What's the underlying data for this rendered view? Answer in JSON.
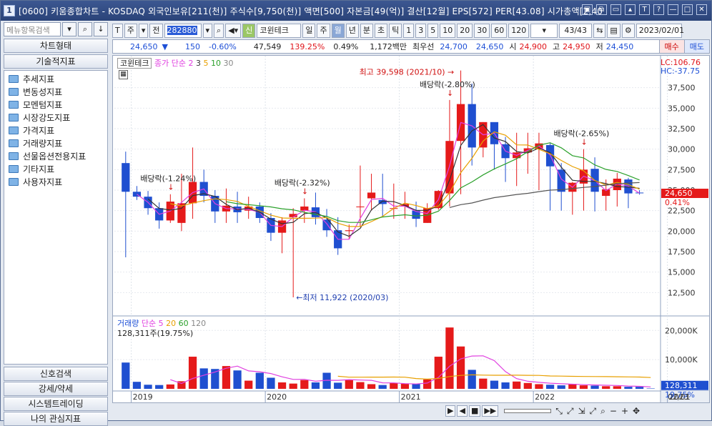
{
  "title": "[0600] 키움종합차트 - KOSDAQ 외국인보유[211(천)] 주식수[9,750(천)] 액면[500] 자본금[49(억)] 결산[12월] EPS[572] PER[43.08] 시가총액[2,40",
  "window_buttons": [
    "▣",
    "⧉",
    "▭",
    "▴",
    "T",
    "?",
    "—",
    "□",
    "✕"
  ],
  "left": {
    "search_placeholder": "메뉴항목검색",
    "tab_chart_type": "차트형태",
    "tab_indicator": "기술적지표",
    "tree_items": [
      "추세지표",
      "변동성지표",
      "모멘텀지표",
      "시장강도지표",
      "가격지표",
      "거래량지표",
      "선물옵션전용지표",
      "기타지표",
      "사용자지표"
    ],
    "bottom_tabs": [
      "신호검색",
      "강세/약세",
      "시스템트레이딩",
      "나의 관심지표"
    ]
  },
  "toolbar": {
    "btn_t": "T",
    "btn_ju": "주",
    "btn_jeon": "전",
    "code": "282880",
    "stock_tag": "신",
    "stock_name": "코윈테크",
    "periods": [
      "일",
      "주",
      "월",
      "년",
      "분",
      "초",
      "틱"
    ],
    "active_period": "월",
    "intervals": [
      "1",
      "3",
      "5",
      "10",
      "20",
      "30",
      "60",
      "120"
    ],
    "page": "43/43",
    "date": "2023/02/01"
  },
  "quote": {
    "price": "24,650",
    "arrow": "▼",
    "change": "150",
    "change_pct": "-0.60%",
    "volume": "47,549",
    "vol_ratio": "139.25%",
    "turnover_pct": "0.49%",
    "amount": "1,172백만",
    "best_ask_label": "최우선",
    "best_ask": "24,700",
    "best_bid": "24,650",
    "open_label": "시",
    "open": "24,900",
    "high_label": "고",
    "high": "24,950",
    "low_label": "저",
    "low": "24,450",
    "buy": "매수",
    "sell": "매도"
  },
  "price_panel": {
    "legend_name": "코윈테크",
    "legend_ma": "종가 단순",
    "ma_periods": [
      "2",
      "3",
      "5",
      "10",
      "30"
    ],
    "lc": "LC:106.76",
    "hc": "HC:-37.75",
    "current_label": "24,650",
    "current_pct": "0.41%",
    "y_ticks": [
      "37,500",
      "35,000",
      "32,500",
      "30,000",
      "27,500",
      "25,000",
      "22,500",
      "20,000",
      "17,500",
      "15,000",
      "12,500"
    ],
    "annotations": {
      "high": "최고 39,598 (2021/10)",
      "low": "최저 11,922 (2020/03)",
      "div1": "배당락(-1.24%)",
      "div2": "배당락(-2.32%)",
      "div3": "배당락(-2.80%)",
      "div4": "배당락(-2.65%)"
    }
  },
  "volume_panel": {
    "legend_name": "거래량",
    "legend_ma": "단순",
    "ma_periods": [
      "5",
      "20",
      "60",
      "120"
    ],
    "last_volume": "128,311주(19.75%)",
    "current_label": "128,311",
    "current_pct": "19.75%",
    "y_ticks": [
      "20,000K",
      "10,000K"
    ]
  },
  "x_axis": [
    "2019",
    "2020",
    "2021",
    "2022",
    "2023"
  ],
  "x_right_label": "02/01",
  "colors": {
    "up": "#e51a1a",
    "down": "#1f4fd0",
    "ma2": "#e040e0",
    "ma5": "#e8a000",
    "ma10": "#2aa02a"
  },
  "chart_data": {
    "type": "candlestick",
    "categories": [
      "2018/12",
      "2019/01",
      "2019/02",
      "2019/03",
      "2019/04",
      "2019/05",
      "2019/06",
      "2019/07",
      "2019/08",
      "2019/09",
      "2019/10",
      "2019/11",
      "2019/12",
      "2020/01",
      "2020/02",
      "2020/03",
      "2020/04",
      "2020/05",
      "2020/06",
      "2020/07",
      "2020/08",
      "2020/09",
      "2020/10",
      "2020/11",
      "2020/12",
      "2021/01",
      "2021/02",
      "2021/03",
      "2021/04",
      "2021/05",
      "2021/06",
      "2021/07",
      "2021/08",
      "2021/09",
      "2021/10",
      "2021/11",
      "2021/12",
      "2022/01",
      "2022/02",
      "2022/03",
      "2022/04",
      "2022/05",
      "2022/06",
      "2022/07",
      "2022/08",
      "2022/09",
      "2022/10",
      "2022/11",
      "2022/12",
      "2023/01",
      "2023/02"
    ],
    "open": [
      28300,
      24800,
      24200,
      22800,
      21300,
      21000,
      23400,
      26000,
      24300,
      22400,
      23000,
      22500,
      23000,
      21600,
      19800,
      21700,
      22500,
      22900,
      21400,
      20100,
      20000,
      23000,
      24000,
      23800,
      22800,
      23000,
      22500,
      21000,
      22800,
      24600,
      31000,
      35500,
      30200,
      33300,
      30600,
      28900,
      29600,
      30000,
      30500,
      27500,
      24800,
      25800,
      27600,
      24300,
      25000,
      26300,
      24700,
      24950
    ],
    "close": [
      24800,
      24200,
      22800,
      21300,
      23600,
      23400,
      26000,
      24300,
      22400,
      23100,
      22300,
      23000,
      21600,
      19800,
      21300,
      22100,
      23000,
      21700,
      20100,
      17900,
      20100,
      23000,
      24700,
      23300,
      22800,
      23300,
      21500,
      22800,
      24900,
      31000,
      35500,
      30200,
      33300,
      30600,
      28900,
      29600,
      30100,
      30700,
      27900,
      24800,
      25900,
      27500,
      24800,
      25100,
      26400,
      24600,
      24650
    ],
    "high": [
      29700,
      25500,
      24900,
      23500,
      24500,
      27000,
      30200,
      27500,
      25000,
      25200,
      24800,
      24200,
      23500,
      22200,
      21700,
      22800,
      24000,
      24700,
      22700,
      21700,
      20800,
      28000,
      27000,
      27000,
      25800,
      24800,
      23600,
      23400,
      25000,
      36000,
      39598,
      38000,
      33300,
      33000,
      31500,
      32000,
      32000,
      32000,
      30800,
      28300,
      26000,
      30000,
      29000,
      26300,
      27100,
      26500,
      25000
    ],
    "low": [
      16800,
      23800,
      22000,
      20300,
      21000,
      20000,
      21500,
      23500,
      21000,
      21000,
      21000,
      21500,
      21000,
      18800,
      17300,
      11922,
      21000,
      20800,
      19300,
      17100,
      19000,
      20500,
      22500,
      21700,
      21500,
      21500,
      20500,
      21000,
      22600,
      23000,
      24500,
      28000,
      29000,
      27500,
      26000,
      25500,
      27000,
      25000,
      22500,
      22500,
      22000,
      22500,
      22400,
      22500,
      23000,
      22800,
      24450
    ],
    "volume_k": [
      9000,
      2400,
      1400,
      1300,
      1500,
      2600,
      11000,
      7000,
      6800,
      7800,
      6300,
      2800,
      5500,
      3800,
      2200,
      1800,
      3000,
      2200,
      5500,
      2100,
      3000,
      2300,
      1600,
      1300,
      2000,
      1700,
      1700,
      3200,
      11000,
      21000,
      14500,
      6500,
      3500,
      2800,
      2200,
      2500,
      2000,
      1600,
      1400,
      1200,
      1700,
      1200,
      1100,
      900,
      900,
      700,
      700,
      128
    ]
  }
}
